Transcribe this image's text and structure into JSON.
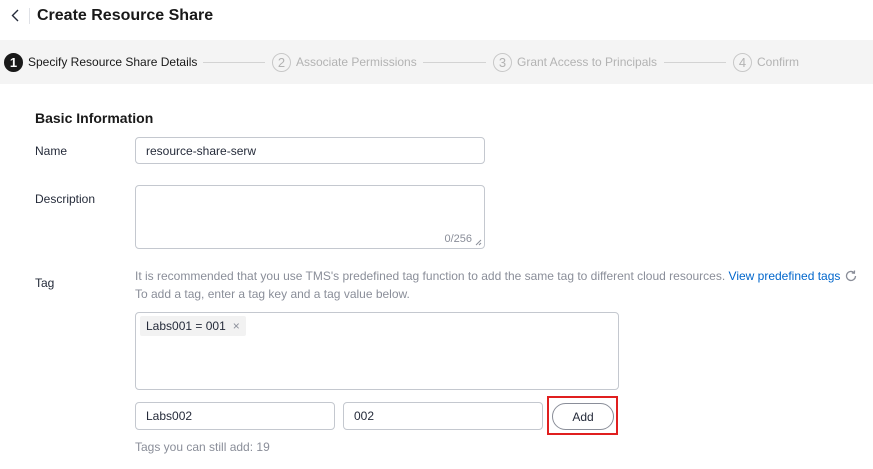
{
  "header": {
    "title": "Create Resource Share"
  },
  "steps": [
    {
      "num": "1",
      "label": "Specify Resource Share Details"
    },
    {
      "num": "2",
      "label": "Associate Permissions"
    },
    {
      "num": "3",
      "label": "Grant Access to Principals"
    },
    {
      "num": "4",
      "label": "Confirm"
    }
  ],
  "form": {
    "section_title": "Basic Information",
    "name_label": "Name",
    "name_value": "resource-share-serw",
    "description_label": "Description",
    "description_counter": "0/256",
    "tag_label": "Tag",
    "tag_hint_line1": "It is recommended that you use TMS's predefined tag function to add the same tag to different cloud resources.",
    "tag_hint_link": "View predefined tags",
    "tag_hint_line2": "To add a tag, enter a tag key and a tag value below.",
    "tags": [
      {
        "text": "Labs001 = 001"
      }
    ],
    "tag_close_glyph": "×",
    "tag_key_value": "Labs002",
    "tag_value_value": "002",
    "add_button": "Add",
    "tags_remaining": "Tags you can still add: 19"
  },
  "colors": {
    "link": "#0066cc",
    "highlight": "#e01f1f",
    "active_step": "#191919"
  }
}
